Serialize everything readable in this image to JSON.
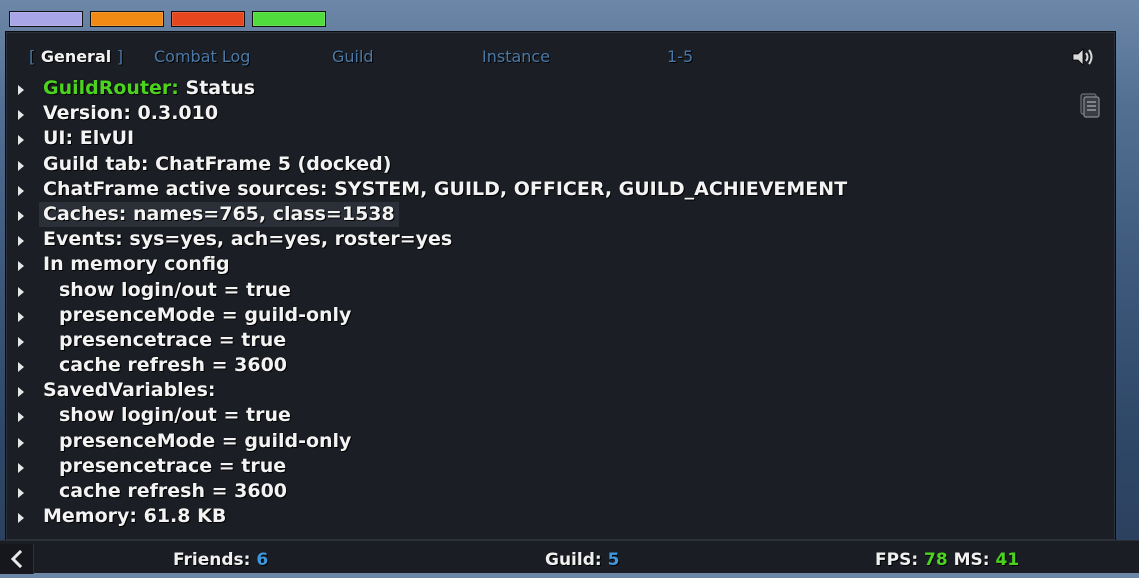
{
  "colors": {
    "strip_1": "#a8a6e6",
    "strip_2": "#f08a14",
    "strip_3": "#e6461e",
    "strip_4": "#4fdc3c",
    "tab_inactive": "#4a79a8",
    "accent_green": "#4cd31f",
    "accent_blue": "#3d98e0"
  },
  "tabs": [
    {
      "label": "General",
      "bracket_left": "[",
      "bracket_right": "]",
      "active": true
    },
    {
      "label": "Combat Log"
    },
    {
      "label": "Guild"
    },
    {
      "label": "Instance"
    },
    {
      "label": "1-5"
    }
  ],
  "icons": {
    "speaker": "speaker-icon",
    "copy": "copy-chat-icon",
    "expand": "triangle-right-icon",
    "back": "chevron-left-icon"
  },
  "chat": {
    "lines": [
      {
        "prefix": "GuildRouter:",
        "text": " Status"
      },
      {
        "text": "Version: 0.3.010"
      },
      {
        "text": "UI: ElvUI"
      },
      {
        "text": "Guild tab: ChatFrame 5 (docked)"
      },
      {
        "text": "ChatFrame active sources: SYSTEM, GUILD, OFFICER, GUILD_ACHIEVEMENT"
      },
      {
        "text": "Caches: names=765, class=1538"
      },
      {
        "text": "Events: sys=yes, ach=yes, roster=yes"
      },
      {
        "text": "In memory config"
      },
      {
        "text": "show login/out = true"
      },
      {
        "text": "presenceMode = guild-only"
      },
      {
        "text": "presencetrace = true"
      },
      {
        "text": "cache refresh = 3600"
      },
      {
        "text": "SavedVariables:"
      },
      {
        "text": "show login/out = true"
      },
      {
        "text": "presenceMode = guild-only"
      },
      {
        "text": "presencetrace = true"
      },
      {
        "text": "cache refresh = 3600"
      },
      {
        "text": "Memory: 61.8 KB"
      }
    ]
  },
  "bottom_bar": {
    "friends_label": "Friends:",
    "friends_value": "6",
    "guild_label": "Guild:",
    "guild_value": "5",
    "fps_label": "FPS:",
    "fps_value": "78",
    "ms_label": "MS:",
    "ms_value": "41"
  }
}
